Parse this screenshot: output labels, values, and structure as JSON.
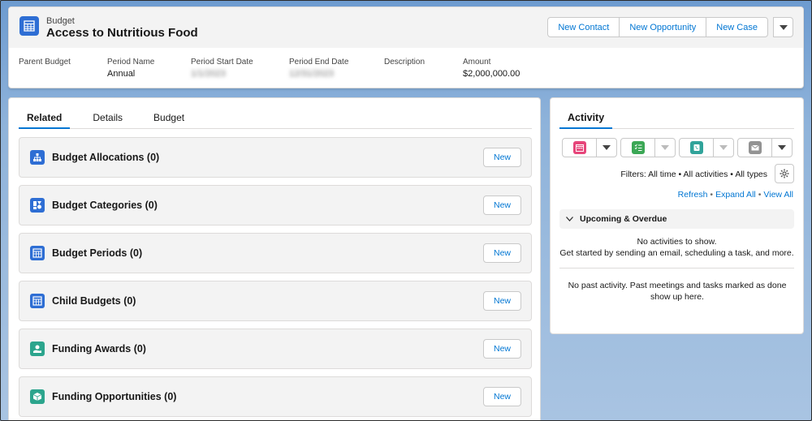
{
  "header": {
    "object_type": "Budget",
    "title": "Access to Nutritious Food",
    "actions": [
      "New Contact",
      "New Opportunity",
      "New Case"
    ],
    "fields": [
      {
        "label": "Parent Budget",
        "value": ""
      },
      {
        "label": "Period Name",
        "value": "Annual"
      },
      {
        "label": "Period Start Date",
        "value": "1/1/2023"
      },
      {
        "label": "Period End Date",
        "value": "12/31/2023"
      },
      {
        "label": "Description",
        "value": ""
      },
      {
        "label": "Amount",
        "value": "$2,000,000.00"
      }
    ]
  },
  "tabs": [
    "Related",
    "Details",
    "Budget"
  ],
  "related_lists": [
    {
      "title": "Budget Allocations (0)",
      "button": "New",
      "color": "#2e6ed4"
    },
    {
      "title": "Budget Categories (0)",
      "button": "New",
      "color": "#2e6ed4"
    },
    {
      "title": "Budget Periods (0)",
      "button": "New",
      "color": "#2e6ed4"
    },
    {
      "title": "Child Budgets (0)",
      "button": "New",
      "color": "#2e6ed4"
    },
    {
      "title": "Funding Awards (0)",
      "button": "New",
      "color": "#2ca58d"
    },
    {
      "title": "Funding Opportunities (0)",
      "button": "New",
      "color": "#2ca58d"
    }
  ],
  "activity": {
    "tab": "Activity",
    "filters": "Filters: All time • All activities • All types",
    "links": [
      "Refresh",
      "Expand All",
      "View All"
    ],
    "upcoming_label": "Upcoming & Overdue",
    "no_activities": "No activities to show.",
    "get_started": "Get started by sending an email, scheduling a task, and more.",
    "no_past": "No past activity. Past meetings and tasks marked as done show up here."
  },
  "colors": {
    "brand": "#0176d3",
    "event": "#e6457a",
    "task": "#3ba755",
    "call": "#30a39a",
    "email": "#939393"
  }
}
